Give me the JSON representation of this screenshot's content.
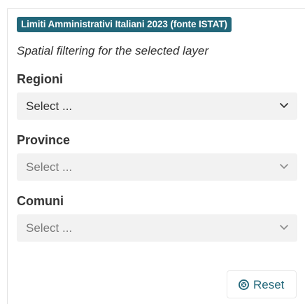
{
  "layer": {
    "title": "Limiti Amministrativi Italiani 2023 (fonte ISTAT)",
    "description": "Spatial filtering for the selected layer"
  },
  "filters": [
    {
      "label": "Regioni",
      "value": "Select ...",
      "enabled": true
    },
    {
      "label": "Province",
      "value": "Select ...",
      "enabled": false
    },
    {
      "label": "Comuni",
      "value": "Select ...",
      "enabled": false
    }
  ],
  "actions": {
    "reset_label": "Reset",
    "reset_icon": "circle-x-icon"
  },
  "colors": {
    "accent": "#22677a",
    "field_bg": "#f2f2f2",
    "text": "#333333",
    "disabled_text": "#7a7a7a"
  }
}
